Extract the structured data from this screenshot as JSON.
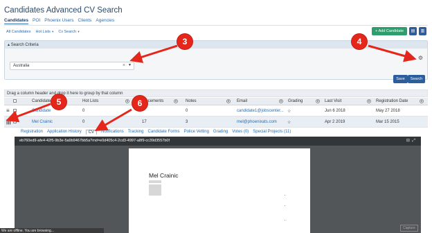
{
  "page_title": "Candidates Advanced CV Search",
  "tabs": [
    "Candidates",
    "POI",
    "Phoenix Users",
    "Clients",
    "Agencies"
  ],
  "filters": [
    {
      "label": "All Candidates",
      "caret": false
    },
    {
      "label": "Hot Lists",
      "caret": true
    },
    {
      "label": "Cv Search",
      "caret": true
    }
  ],
  "actions": {
    "add_candidate": "+ Add Candidate"
  },
  "search_panel": {
    "title": "Search Criteria",
    "location_value": "Australia",
    "save_label": "Save",
    "search_label": "Search"
  },
  "grid": {
    "group_hint": "Drag a column header and drop it here to group by that column",
    "columns": [
      "Candidate",
      "Hot Lists",
      "Placements",
      "Notes",
      "Email",
      "Grading",
      "Last Visit",
      "Registration Date"
    ],
    "rows": [
      {
        "candidate": "Candidate",
        "hot_lists": "0",
        "placements": "",
        "notes": "0",
        "email": "candidate1@jobscenter...",
        "grading": "☆",
        "last_visit": "Jun 6 2018",
        "registration_date": "May 27 2018"
      },
      {
        "candidate": "Mel Crainic",
        "hot_lists": "0",
        "placements": "17",
        "notes": "3",
        "email": "mel@phoenixats.com",
        "grading": "☆",
        "last_visit": "Apr 2 2019",
        "registration_date": "Mar 15 2015"
      }
    ]
  },
  "detail_tabs": [
    "Registration",
    "Application History",
    "CV",
    "Notifications",
    "Tracking",
    "Candidate Forms",
    "Police Vetting",
    "Grading",
    "Votes (0)",
    "Special Projects (11)"
  ],
  "active_detail_tab": "CV",
  "viewer": {
    "document_id": "eb760ed9-afe4-42f5-9b3e-5a9b9467bb5a?md=e0d405c4-2cd3-4997-a8f9-cc39d3557b0f",
    "doc_name": "Mel Crainic",
    "capture_label": "Capture",
    "offline_text": "We are offline. You are browsing..."
  },
  "callouts": [
    "3",
    "4",
    "5",
    "6"
  ],
  "colors": {
    "accent": "#2c5d9c",
    "callout": "#e5261b",
    "add_button": "#2f9e6f",
    "selected_row": "#e9eef5"
  }
}
